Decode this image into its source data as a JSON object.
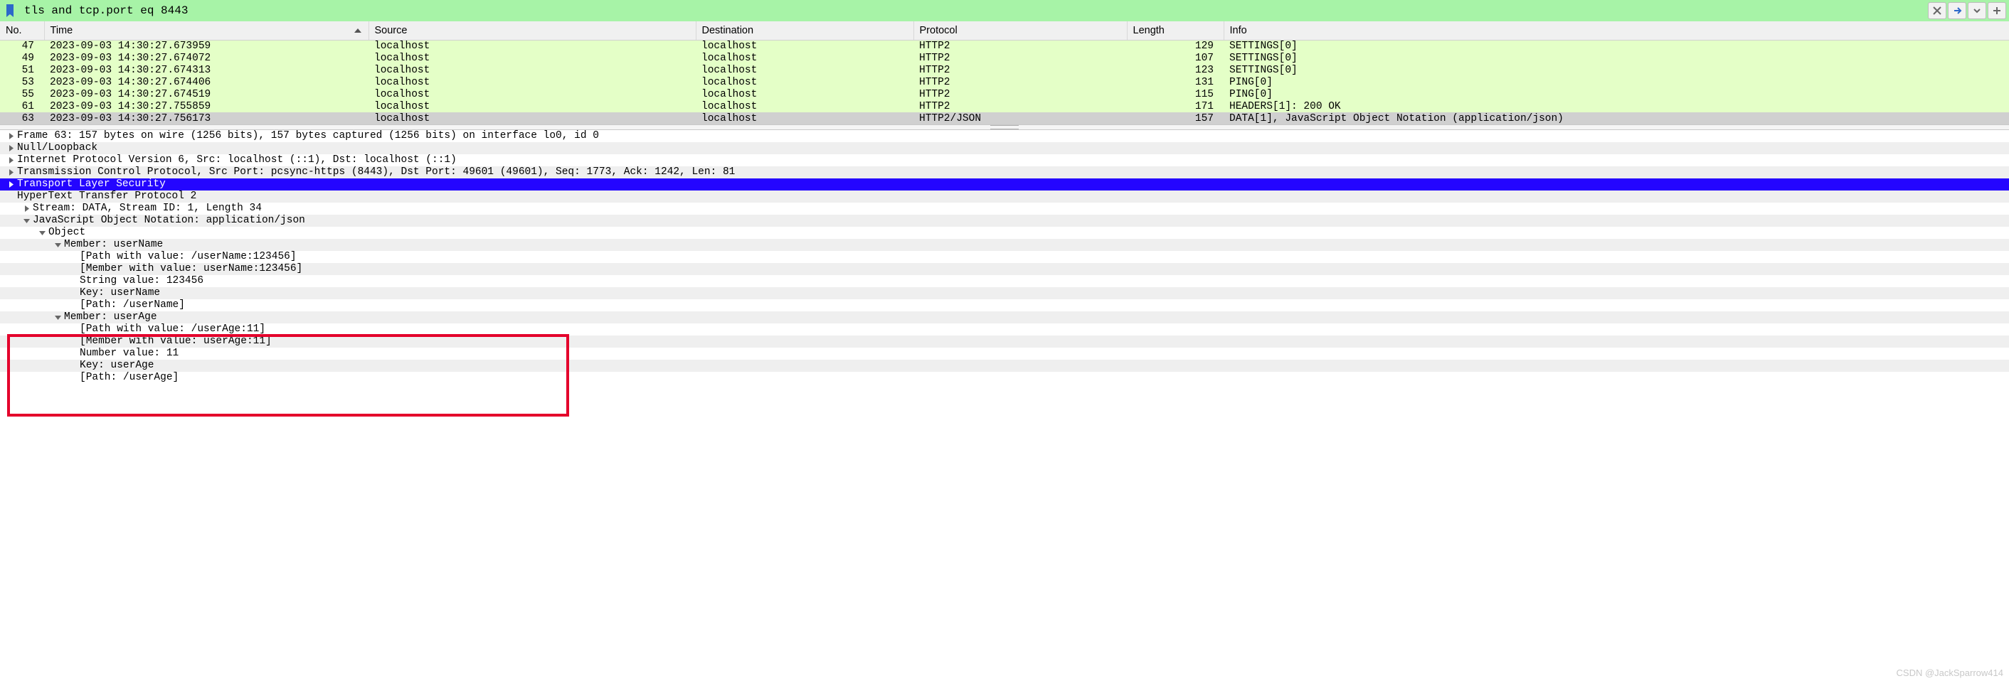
{
  "filter": {
    "text": "tls and tcp.port eq 8443"
  },
  "columns": {
    "no": "No.",
    "time": "Time",
    "source": "Source",
    "destination": "Destination",
    "protocol": "Protocol",
    "length": "Length",
    "info": "Info"
  },
  "packets": [
    {
      "no": "47",
      "time": "2023-09-03 14:30:27.673959",
      "src": "localhost",
      "dst": "localhost",
      "proto": "HTTP2",
      "len": "129",
      "info": "SETTINGS[0]",
      "cls": "http"
    },
    {
      "no": "49",
      "time": "2023-09-03 14:30:27.674072",
      "src": "localhost",
      "dst": "localhost",
      "proto": "HTTP2",
      "len": "107",
      "info": "SETTINGS[0]",
      "cls": "http"
    },
    {
      "no": "51",
      "time": "2023-09-03 14:30:27.674313",
      "src": "localhost",
      "dst": "localhost",
      "proto": "HTTP2",
      "len": "123",
      "info": "SETTINGS[0]",
      "cls": "http"
    },
    {
      "no": "53",
      "time": "2023-09-03 14:30:27.674406",
      "src": "localhost",
      "dst": "localhost",
      "proto": "HTTP2",
      "len": "131",
      "info": "PING[0]",
      "cls": "http"
    },
    {
      "no": "55",
      "time": "2023-09-03 14:30:27.674519",
      "src": "localhost",
      "dst": "localhost",
      "proto": "HTTP2",
      "len": "115",
      "info": "PING[0]",
      "cls": "http"
    },
    {
      "no": "61",
      "time": "2023-09-03 14:30:27.755859",
      "src": "localhost",
      "dst": "localhost",
      "proto": "HTTP2",
      "len": "171",
      "info": "HEADERS[1]: 200 OK",
      "cls": "http"
    },
    {
      "no": "63",
      "time": "2023-09-03 14:30:27.756173",
      "src": "localhost",
      "dst": "localhost",
      "proto": "HTTP2/JSON",
      "len": "157",
      "info": "DATA[1], JavaScript Object Notation (application/json)",
      "cls": "selected"
    }
  ],
  "tree": [
    {
      "indent": 0,
      "toggle": "closed",
      "text": "Frame 63: 157 bytes on wire (1256 bits), 157 bytes captured (1256 bits) on interface lo0, id 0",
      "sel": false,
      "alt": false
    },
    {
      "indent": 0,
      "toggle": "closed",
      "text": "Null/Loopback",
      "sel": false,
      "alt": true
    },
    {
      "indent": 0,
      "toggle": "closed",
      "text": "Internet Protocol Version 6, Src: localhost (::1), Dst: localhost (::1)",
      "sel": false,
      "alt": false
    },
    {
      "indent": 0,
      "toggle": "closed",
      "text": "Transmission Control Protocol, Src Port: pcsync-https (8443), Dst Port: 49601 (49601), Seq: 1773, Ack: 1242, Len: 81",
      "sel": false,
      "alt": true
    },
    {
      "indent": 0,
      "toggle": "closed",
      "text": "Transport Layer Security",
      "sel": true,
      "alt": false
    },
    {
      "indent": 0,
      "toggle": "none",
      "text": "HyperText Transfer Protocol 2",
      "sel": false,
      "alt": true
    },
    {
      "indent": 1,
      "toggle": "closed",
      "text": "Stream: DATA, Stream ID: 1, Length 34",
      "sel": false,
      "alt": false
    },
    {
      "indent": 1,
      "toggle": "open",
      "text": "JavaScript Object Notation: application/json",
      "sel": false,
      "alt": true
    },
    {
      "indent": 2,
      "toggle": "open",
      "text": "Object",
      "sel": false,
      "alt": false
    },
    {
      "indent": 3,
      "toggle": "open",
      "text": "Member: userName",
      "sel": false,
      "alt": true
    },
    {
      "indent": 4,
      "toggle": "none",
      "text": "[Path with value: /userName:123456]",
      "sel": false,
      "alt": false
    },
    {
      "indent": 4,
      "toggle": "none",
      "text": "[Member with value: userName:123456]",
      "sel": false,
      "alt": true
    },
    {
      "indent": 4,
      "toggle": "none",
      "text": "String value: 123456",
      "sel": false,
      "alt": false
    },
    {
      "indent": 4,
      "toggle": "none",
      "text": "Key: userName",
      "sel": false,
      "alt": true
    },
    {
      "indent": 4,
      "toggle": "none",
      "text": "[Path: /userName]",
      "sel": false,
      "alt": false
    },
    {
      "indent": 3,
      "toggle": "open",
      "text": "Member: userAge",
      "sel": false,
      "alt": true
    },
    {
      "indent": 4,
      "toggle": "none",
      "text": "[Path with value: /userAge:11]",
      "sel": false,
      "alt": false
    },
    {
      "indent": 4,
      "toggle": "none",
      "text": "[Member with value: userAge:11]",
      "sel": false,
      "alt": true
    },
    {
      "indent": 4,
      "toggle": "none",
      "text": "Number value: 11",
      "sel": false,
      "alt": false
    },
    {
      "indent": 4,
      "toggle": "none",
      "text": "Key: userAge",
      "sel": false,
      "alt": true
    },
    {
      "indent": 4,
      "toggle": "none",
      "text": "[Path: /userAge]",
      "sel": false,
      "alt": false
    }
  ],
  "watermark": "CSDN @JackSparrow414"
}
